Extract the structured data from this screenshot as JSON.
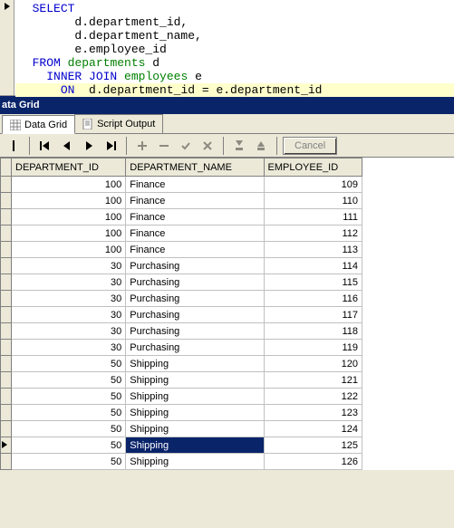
{
  "sql": {
    "select": "SELECT",
    "col1": "d.department_id,",
    "col2": "d.department_name,",
    "col3": "e.employee_id",
    "from": "FROM",
    "table1": "departments",
    "alias1": "d",
    "join": "INNER JOIN",
    "table2": "employees",
    "alias2": "e",
    "on": "ON",
    "cond": "d.department_id = e.department_id"
  },
  "titleBar": "ata Grid",
  "tabs": {
    "dataGrid": "Data Grid",
    "scriptOutput": "Script Output"
  },
  "toolbar": {
    "cancel": "Cancel"
  },
  "columns": [
    "DEPARTMENT_ID",
    "DEPARTMENT_NAME",
    "EMPLOYEE_ID"
  ],
  "rows": [
    {
      "dept_id": 100,
      "dept_name": "Finance",
      "emp_id": 109
    },
    {
      "dept_id": 100,
      "dept_name": "Finance",
      "emp_id": 110
    },
    {
      "dept_id": 100,
      "dept_name": "Finance",
      "emp_id": 111
    },
    {
      "dept_id": 100,
      "dept_name": "Finance",
      "emp_id": 112
    },
    {
      "dept_id": 100,
      "dept_name": "Finance",
      "emp_id": 113
    },
    {
      "dept_id": 30,
      "dept_name": "Purchasing",
      "emp_id": 114
    },
    {
      "dept_id": 30,
      "dept_name": "Purchasing",
      "emp_id": 115
    },
    {
      "dept_id": 30,
      "dept_name": "Purchasing",
      "emp_id": 116
    },
    {
      "dept_id": 30,
      "dept_name": "Purchasing",
      "emp_id": 117
    },
    {
      "dept_id": 30,
      "dept_name": "Purchasing",
      "emp_id": 118
    },
    {
      "dept_id": 30,
      "dept_name": "Purchasing",
      "emp_id": 119
    },
    {
      "dept_id": 50,
      "dept_name": "Shipping",
      "emp_id": 120
    },
    {
      "dept_id": 50,
      "dept_name": "Shipping",
      "emp_id": 121
    },
    {
      "dept_id": 50,
      "dept_name": "Shipping",
      "emp_id": 122
    },
    {
      "dept_id": 50,
      "dept_name": "Shipping",
      "emp_id": 123
    },
    {
      "dept_id": 50,
      "dept_name": "Shipping",
      "emp_id": 124
    },
    {
      "dept_id": 50,
      "dept_name": "Shipping",
      "emp_id": 125
    },
    {
      "dept_id": 50,
      "dept_name": "Shipping",
      "emp_id": 126
    }
  ],
  "selectedRow": 17,
  "chart_data": {
    "type": "table",
    "title": "SQL Query Result",
    "columns": [
      "DEPARTMENT_ID",
      "DEPARTMENT_NAME",
      "EMPLOYEE_ID"
    ],
    "rows": [
      [
        100,
        "Finance",
        109
      ],
      [
        100,
        "Finance",
        110
      ],
      [
        100,
        "Finance",
        111
      ],
      [
        100,
        "Finance",
        112
      ],
      [
        100,
        "Finance",
        113
      ],
      [
        30,
        "Purchasing",
        114
      ],
      [
        30,
        "Purchasing",
        115
      ],
      [
        30,
        "Purchasing",
        116
      ],
      [
        30,
        "Purchasing",
        117
      ],
      [
        30,
        "Purchasing",
        118
      ],
      [
        30,
        "Purchasing",
        119
      ],
      [
        50,
        "Shipping",
        120
      ],
      [
        50,
        "Shipping",
        121
      ],
      [
        50,
        "Shipping",
        122
      ],
      [
        50,
        "Shipping",
        123
      ],
      [
        50,
        "Shipping",
        124
      ],
      [
        50,
        "Shipping",
        125
      ],
      [
        50,
        "Shipping",
        126
      ]
    ]
  }
}
